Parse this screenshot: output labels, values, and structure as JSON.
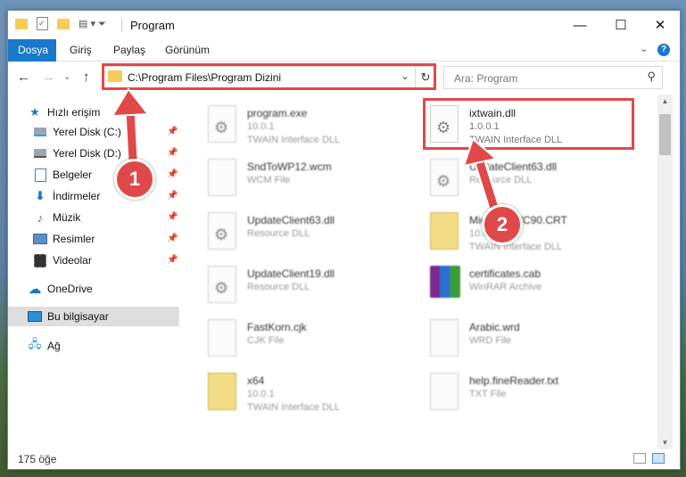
{
  "window": {
    "title": "Program",
    "controls": {
      "minimize": "—",
      "maximize": "☐",
      "close": "✕"
    }
  },
  "ribbon": {
    "tabs": [
      "Dosya",
      "Giriş",
      "Paylaş",
      "Görünüm"
    ],
    "expand_icon": "⌄",
    "help": "?"
  },
  "navigation": {
    "back": "←",
    "forward": "→",
    "history": "⌄",
    "up": "↑",
    "address_path": "C:\\Program Files\\Program Dizini",
    "address_dropdown": "⌄",
    "refresh": "↻",
    "search_placeholder": "Ara: Program",
    "search_icon": "⚲"
  },
  "sidebar": {
    "quick_access": "Hızlı erişim",
    "items": [
      {
        "label": "Yerel Disk (C:)",
        "icon": "drive-icon"
      },
      {
        "label": "Yerel Disk (D:)",
        "icon": "drive-icon"
      },
      {
        "label": "Belgeler",
        "icon": "documents-icon"
      },
      {
        "label": "İndirmeler",
        "icon": "download-icon"
      },
      {
        "label": "Müzik",
        "icon": "music-icon"
      },
      {
        "label": "Resimler",
        "icon": "pictures-icon"
      },
      {
        "label": "Videolar",
        "icon": "video-icon"
      }
    ],
    "onedrive": "OneDrive",
    "this_pc": "Bu bilgisayar",
    "network": "Ağ"
  },
  "files": [
    {
      "name": "program.exe",
      "line2": "10.0.1",
      "line3": "TWAIN Interface DLL",
      "icon": "exe"
    },
    {
      "name": "ixtwain.dll",
      "line2": "1.0.0.1",
      "line3": "TWAIN Interface DLL",
      "icon": "dll"
    },
    {
      "name": "SndToWP12.wcm",
      "line2": "WCM File",
      "line3": "",
      "icon": "doc"
    },
    {
      "name": "UpdateClient63.dll",
      "line2": "Resource DLL",
      "line3": "",
      "icon": "dll"
    },
    {
      "name": "UpdateClient63.dll",
      "line2": "Resource DLL",
      "line3": "",
      "icon": "dll"
    },
    {
      "name": "Microsoft.VC90.CRT",
      "line2": "10.0.1",
      "line3": "TWAIN Interface DLL",
      "icon": "zip"
    },
    {
      "name": "UpdateClient19.dll",
      "line2": "Resource DLL",
      "line3": "",
      "icon": "dll"
    },
    {
      "name": "certificates.cab",
      "line2": "WinRAR Archive",
      "line3": "",
      "icon": "rar"
    },
    {
      "name": "FastKorn.cjk",
      "line2": "CJK File",
      "line3": "",
      "icon": "doc"
    },
    {
      "name": "Arabic.wrd",
      "line2": "WRD File",
      "line3": "",
      "icon": "doc"
    },
    {
      "name": "x64",
      "line2": "10.0.1",
      "line3": "TWAIN Interface DLL",
      "icon": "zip"
    },
    {
      "name": "help.fineReader.txt",
      "line2": "TXT File",
      "line3": "",
      "icon": "doc"
    }
  ],
  "status": {
    "item_count": "175 öğe"
  },
  "callouts": [
    "1",
    "2"
  ],
  "colors": {
    "accent": "#1979ca",
    "highlight": "#e44848"
  }
}
